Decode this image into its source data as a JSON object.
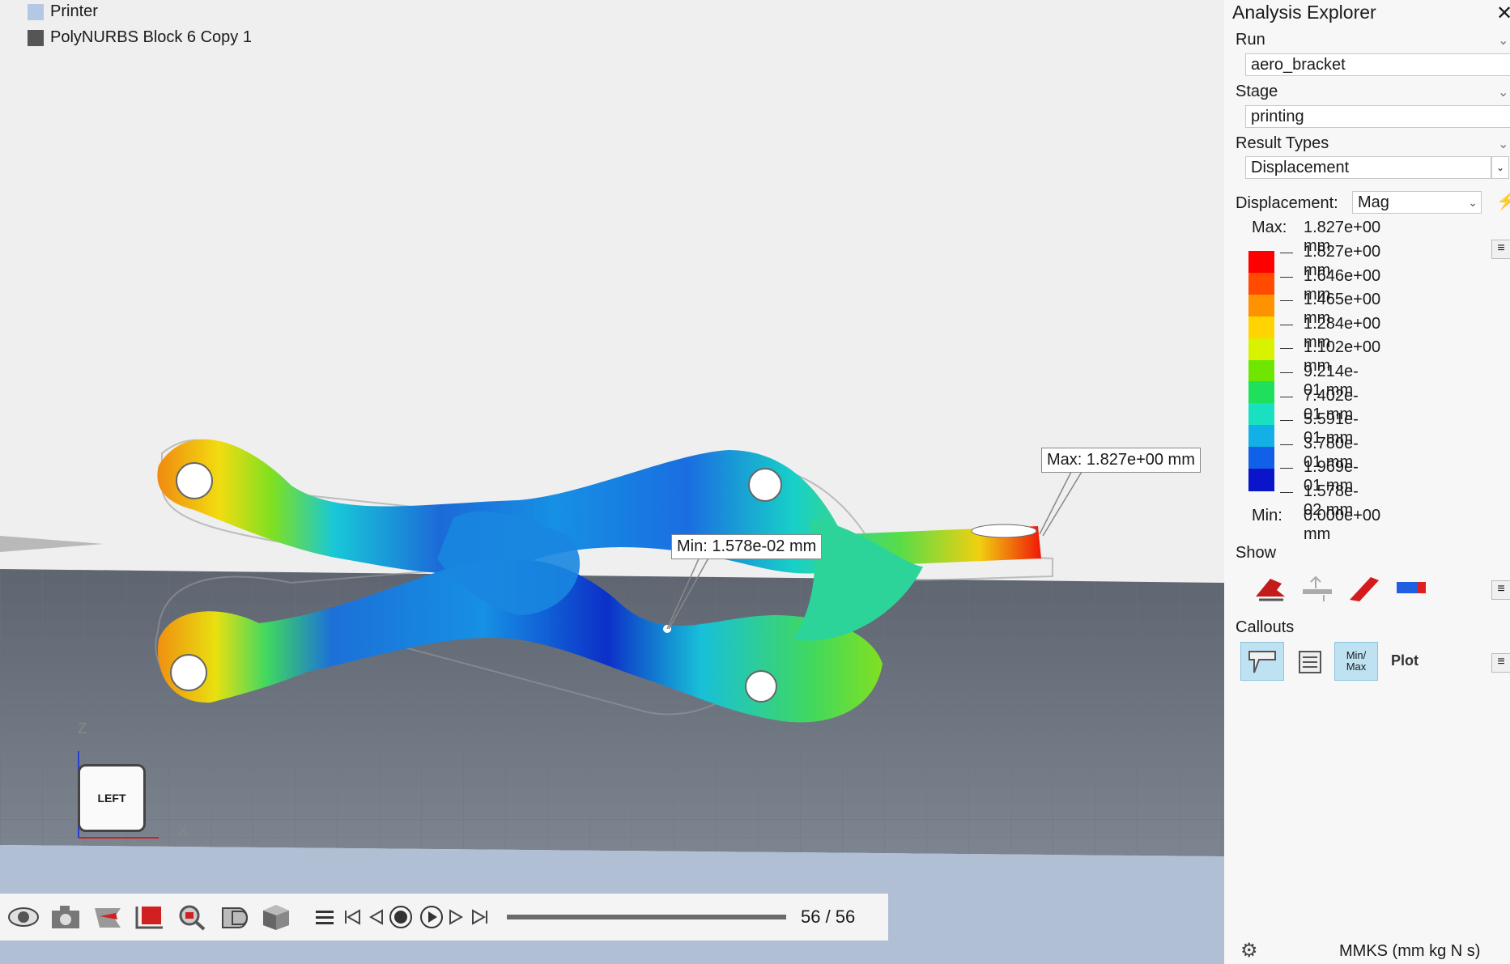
{
  "legend": [
    {
      "label": "Printer",
      "color": "#b4c8e4"
    },
    {
      "label": "PolyNURBS Block 6 Copy 1",
      "color": "#555555"
    }
  ],
  "callouts": {
    "max": "Max: 1.827e+00 mm",
    "min": "Min: 1.578e-02 mm"
  },
  "viewcube": {
    "face": "LEFT",
    "axis_z": "Z",
    "axis_x": "X"
  },
  "toolbar": {
    "icons": [
      "eye-icon",
      "camera-icon",
      "section-cut-icon",
      "frame-icon",
      "zoom-icon",
      "shading-icon",
      "cube-icon"
    ],
    "menu_icon": "hamburger-icon",
    "playback": [
      "skip-start-icon",
      "step-back-icon",
      "stop-icon",
      "play-icon",
      "step-forward-icon",
      "skip-end-icon"
    ],
    "frame_label": "56 / 56",
    "progress": 1.0
  },
  "panel": {
    "title": "Analysis Explorer",
    "close": "✕",
    "run_label": "Run",
    "run_value": "aero_bracket",
    "stage_label": "Stage",
    "stage_value": "printing",
    "result_types_label": "Result Types",
    "result_types_value": "Displacement",
    "displacement_label": "Displacement:",
    "displacement_value": "Mag",
    "max_label": "Max:",
    "max_value": "1.827e+00 mm",
    "min_label": "Min:",
    "min_value": "0.000e+00 mm",
    "colorbar_ticks": [
      "1.827e+00 mm",
      "1.646e+00 mm",
      "1.465e+00 mm",
      "1.284e+00 mm",
      "1.102e+00 mm",
      "9.214e-01 mm",
      "7.402e-01 mm",
      "5.591e-01 mm",
      "3.780e-01 mm",
      "1.969e-01 mm",
      "1.578e-02 mm"
    ],
    "colorbar_colors": [
      "#ff0000",
      "#ff4a00",
      "#ff9200",
      "#ffd400",
      "#d8f200",
      "#6ee600",
      "#1ee05c",
      "#18e0c0",
      "#12b0e6",
      "#1060e8",
      "#0a14c8"
    ],
    "show_label": "Show",
    "callouts_label": "Callouts",
    "minmax_label": "Min/\nMax",
    "plot_label": "Plot"
  },
  "status": {
    "units": "MMKS (mm kg N s)"
  }
}
